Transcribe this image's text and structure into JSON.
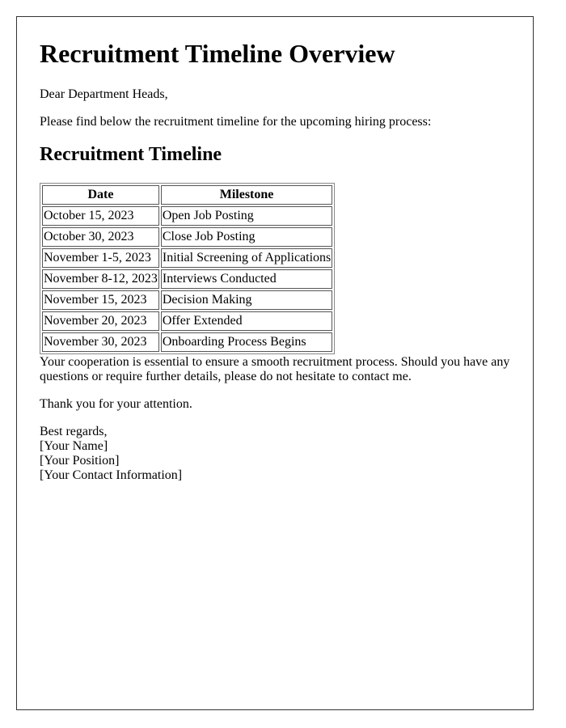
{
  "document": {
    "title": "Recruitment Timeline Overview",
    "greeting": "Dear Department Heads,",
    "intro": "Please find below the recruitment timeline for the upcoming hiring process:",
    "section_heading": "Recruitment Timeline",
    "table": {
      "headers": [
        "Date",
        "Milestone"
      ],
      "rows": [
        [
          "October 15, 2023",
          "Open Job Posting"
        ],
        [
          "October 30, 2023",
          "Close Job Posting"
        ],
        [
          "November 1-5, 2023",
          "Initial Screening of Applications"
        ],
        [
          "November 8-12, 2023",
          "Interviews Conducted"
        ],
        [
          "November 15, 2023",
          "Decision Making"
        ],
        [
          "November 20, 2023",
          "Offer Extended"
        ],
        [
          "November 30, 2023",
          "Onboarding Process Begins"
        ]
      ]
    },
    "cooperation": "Your cooperation is essential to ensure a smooth recruitment process. Should you have any questions or require further details, please do not hesitate to contact me.",
    "thanks": "Thank you for your attention.",
    "signature": {
      "closing": "Best regards,",
      "name": "[Your Name]",
      "position": "[Your Position]",
      "contact": "[Your Contact Information]"
    }
  }
}
